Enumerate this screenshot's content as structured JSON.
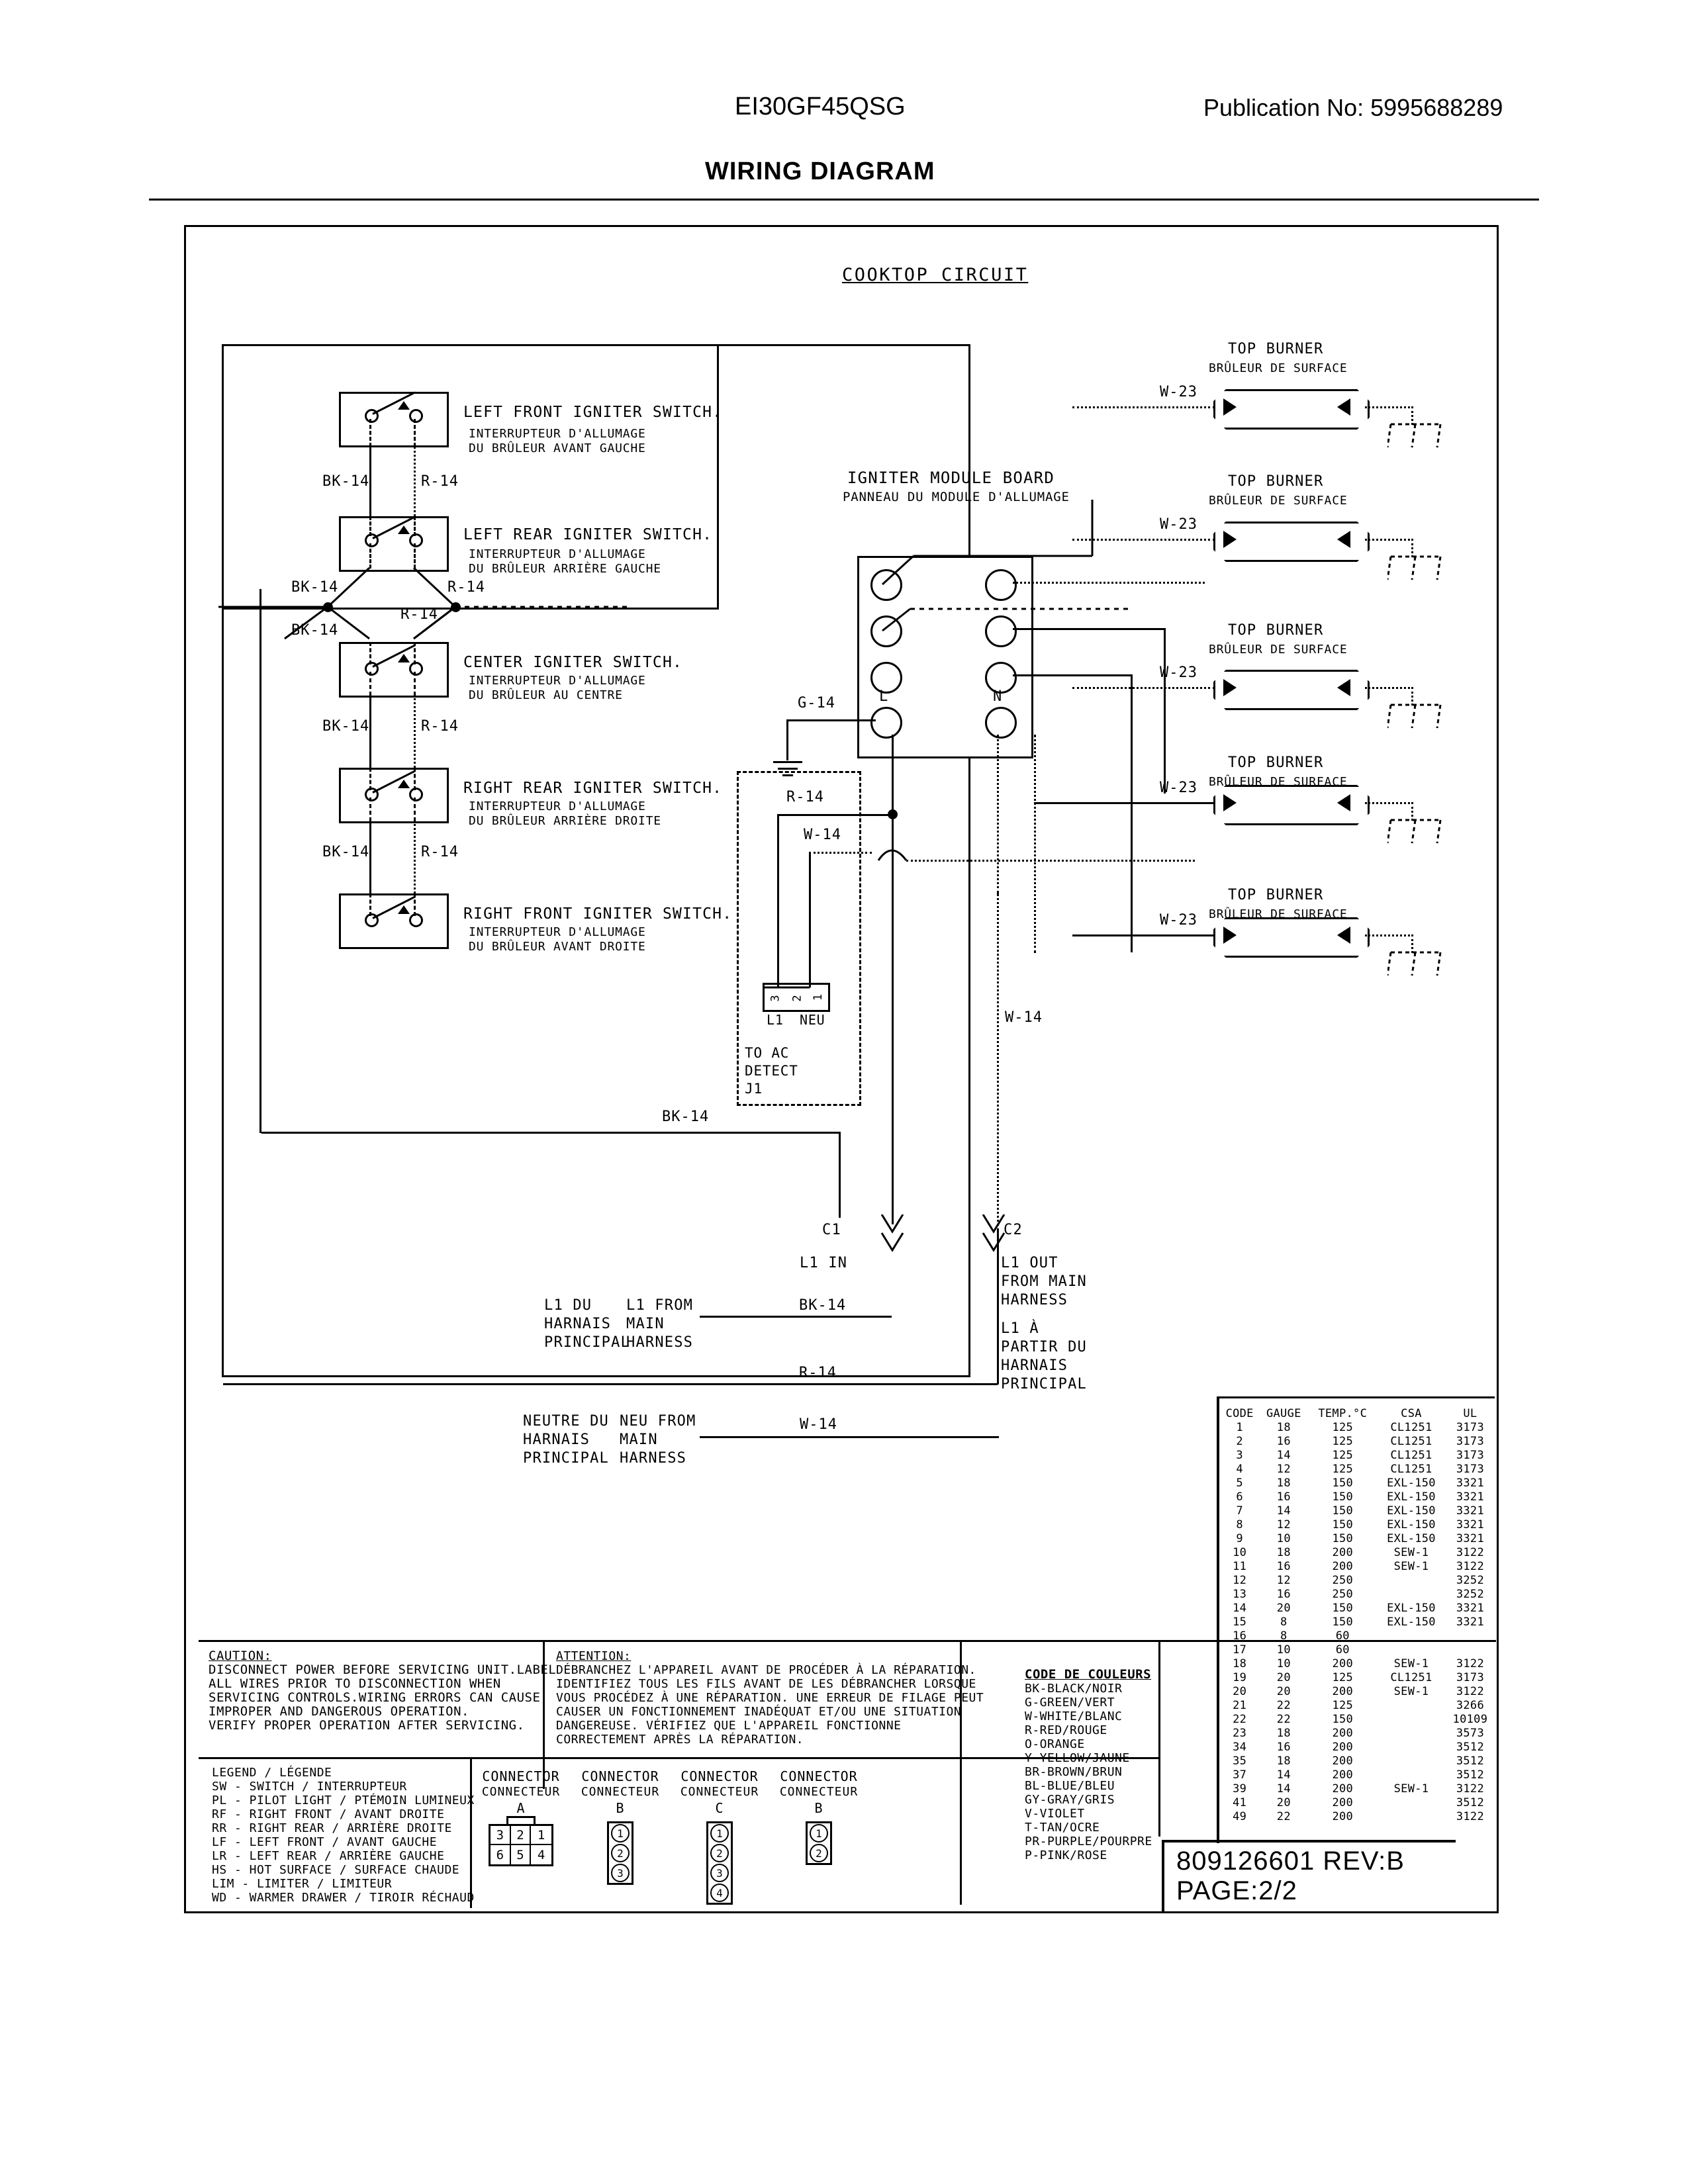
{
  "header": {
    "model": "EI30GF45QSG",
    "publication_label": "Publication No:  5995688289",
    "title": "WIRING DIAGRAM"
  },
  "diagram": {
    "section_title": "COOKTOP CIRCUIT",
    "module_board": {
      "title_en": "IGNITER MODULE BOARD",
      "title_fr": "PANNEAU DU MODULE D'ALLUMAGE",
      "terminal_l": "L",
      "terminal_n": "N",
      "ground_wire": "G-14"
    },
    "switches": [
      {
        "name_en": "LEFT FRONT IGNITER SWITCH.",
        "name_fr_1": "INTERRUPTEUR D'ALLUMAGE",
        "name_fr_2": "DU BRÛLEUR AVANT GAUCHE"
      },
      {
        "name_en": "LEFT REAR IGNITER SWITCH.",
        "name_fr_1": "INTERRUPTEUR D'ALLUMAGE",
        "name_fr_2": "DU BRÛLEUR ARRIÈRE GAUCHE"
      },
      {
        "name_en": "CENTER IGNITER SWITCH.",
        "name_fr_1": "INTERRUPTEUR D'ALLUMAGE",
        "name_fr_2": "DU BRÛLEUR AU CENTRE"
      },
      {
        "name_en": "RIGHT REAR IGNITER SWITCH.",
        "name_fr_1": "INTERRUPTEUR D'ALLUMAGE",
        "name_fr_2": "DU BRÛLEUR ARRIÈRE DROITE"
      },
      {
        "name_en": "RIGHT FRONT IGNITER SWITCH.",
        "name_fr_1": "INTERRUPTEUR D'ALLUMAGE",
        "name_fr_2": "DU BRÛLEUR AVANT DROITE"
      }
    ],
    "burners": [
      {
        "name_en": "TOP BURNER",
        "name_fr": "BRÛLEUR DE SURFACE",
        "wire": "W-23"
      },
      {
        "name_en": "TOP BURNER",
        "name_fr": "BRÛLEUR DE SURFACE",
        "wire": "W-23"
      },
      {
        "name_en": "TOP BURNER",
        "name_fr": "BRÛLEUR DE SURFACE",
        "wire": "W-23"
      },
      {
        "name_en": "TOP BURNER",
        "name_fr": "BRÛLEUR DE SURFACE",
        "wire": "W-23"
      },
      {
        "name_en": "TOP BURNER",
        "name_fr": "BRÛLEUR DE SURFACE",
        "wire": "W-23"
      }
    ],
    "wire_labels": {
      "bk14": "BK-14",
      "r14": "R-14",
      "w14": "W-14",
      "w23": "W-23",
      "g14": "G-14"
    },
    "ac_detect": {
      "r14": "R-14",
      "w14": "W-14",
      "pin3": "3",
      "pin2": "2",
      "pin1": "1",
      "l1": "L1",
      "neu": "NEU",
      "caption_1": "TO AC",
      "caption_2": "DETECT",
      "caption_3": "J1"
    },
    "harness": {
      "c1": "C1",
      "c2": "C2",
      "l1_in": "L1 IN",
      "c2_en_1": "L1 OUT",
      "c2_en_2": "FROM MAIN",
      "c2_en_3": "HARNESS",
      "c2_fr_1": "L1 À",
      "c2_fr_2": "PARTIR DU",
      "c2_fr_3": "HARNAIS",
      "c2_fr_4": "PRINCIPAL",
      "l1_fr_1": "L1 DU",
      "l1_fr_2": "HARNAIS",
      "l1_fr_3": "PRINCIPAL",
      "l1_en_1": "L1 FROM",
      "l1_en_2": "MAIN",
      "l1_en_3": "HARNESS",
      "neu_fr_1": "NEUTRE DU",
      "neu_fr_2": "HARNAIS",
      "neu_fr_3": "PRINCIPAL",
      "neu_en_1": "NEU FROM",
      "neu_en_2": "MAIN",
      "neu_en_3": "HARNESS",
      "bk14": "BK-14",
      "r14": "R-14",
      "w14": "W-14"
    }
  },
  "caution": {
    "heading": "CAUTION:",
    "lines": [
      "DISCONNECT POWER BEFORE SERVICING UNIT.LABEL",
      "ALL WIRES PRIOR TO DISCONNECTION WHEN",
      "SERVICING CONTROLS.WIRING ERRORS CAN CAUSE",
      "IMPROPER AND DANGEROUS OPERATION.",
      "VERIFY PROPER OPERATION AFTER SERVICING."
    ]
  },
  "attention": {
    "heading": "ATTENTION:",
    "lines": [
      "DÉBRANCHEZ L'APPAREIL AVANT DE PROCÉDER À LA RÉPARATION.",
      "IDENTIFIEZ TOUS LES FILS AVANT DE LES DÉBRANCHER LORSQUE",
      "VOUS PROCÉDEZ À UNE RÉPARATION. UNE ERREUR DE FILAGE PEUT",
      "CAUSER UN FONCTIONNEMENT INADÉQUAT ET/OU UNE SITUATION",
      "DANGEREUSE. VÉRIFIEZ QUE L'APPAREIL FONCTIONNE",
      "CORRECTEMENT APRÈS LA RÉPARATION."
    ]
  },
  "color_code": {
    "heading": "CODE DE COULEURS",
    "entries": [
      "BK-BLACK/NOIR",
      "G-GREEN/VERT",
      "W-WHITE/BLANC",
      "R-RED/ROUGE",
      "O-ORANGE",
      "Y-YELLOW/JAUNE",
      "BR-BROWN/BRUN",
      "BL-BLUE/BLEU",
      "GY-GRAY/GRIS",
      "V-VIOLET",
      "T-TAN/OCRE",
      "PR-PURPLE/POURPRE",
      "P-PINK/ROSE"
    ]
  },
  "legend": {
    "heading": "LEGEND / LÉGENDE",
    "entries": [
      "SW - SWITCH / INTERRUPTEUR",
      "PL - PILOT LIGHT / PTÉMOIN LUMINEUX",
      "RF - RIGHT FRONT / AVANT DROITE",
      "RR - RIGHT REAR / ARRIÈRE DROITE",
      "LF - LEFT FRONT / AVANT GAUCHE",
      "LR - LEFT REAR / ARRIÈRE GAUCHE",
      "HS - HOT SURFACE / SURFACE CHAUDE",
      "LIM - LIMITER / LIMITEUR",
      "WD - WARMER DRAWER / TIROIR RÉCHAUD"
    ]
  },
  "connectors": [
    {
      "title_en": "CONNECTOR",
      "title_fr": "CONNECTEUR",
      "id": "A",
      "type": "grid6",
      "pins": [
        "3",
        "2",
        "1",
        "6",
        "5",
        "4"
      ]
    },
    {
      "title_en": "CONNECTOR",
      "title_fr": "CONNECTEUR",
      "id": "B",
      "type": "vertical",
      "pins": [
        "1",
        "2",
        "3"
      ]
    },
    {
      "title_en": "CONNECTOR",
      "title_fr": "CONNECTEUR",
      "id": "C",
      "type": "vertical",
      "pins": [
        "1",
        "2",
        "3",
        "4"
      ]
    },
    {
      "title_en": "CONNECTOR",
      "title_fr": "CONNECTEUR",
      "id": "B",
      "type": "vertical",
      "pins": [
        "1",
        "2"
      ]
    }
  ],
  "wire_table": {
    "headers": [
      "CODE",
      "GAUGE",
      "TEMP.°C",
      "CSA",
      "UL"
    ],
    "rows": [
      [
        "1",
        "18",
        "125",
        "CL1251",
        "3173"
      ],
      [
        "2",
        "16",
        "125",
        "CL1251",
        "3173"
      ],
      [
        "3",
        "14",
        "125",
        "CL1251",
        "3173"
      ],
      [
        "4",
        "12",
        "125",
        "CL1251",
        "3173"
      ],
      [
        "5",
        "18",
        "150",
        "EXL-150",
        "3321"
      ],
      [
        "6",
        "16",
        "150",
        "EXL-150",
        "3321"
      ],
      [
        "7",
        "14",
        "150",
        "EXL-150",
        "3321"
      ],
      [
        "8",
        "12",
        "150",
        "EXL-150",
        "3321"
      ],
      [
        "9",
        "10",
        "150",
        "EXL-150",
        "3321"
      ],
      [
        "10",
        "18",
        "200",
        "SEW-1",
        "3122"
      ],
      [
        "11",
        "16",
        "200",
        "SEW-1",
        "3122"
      ],
      [
        "12",
        "12",
        "250",
        "",
        "3252"
      ],
      [
        "13",
        "16",
        "250",
        "",
        "3252"
      ],
      [
        "14",
        "20",
        "150",
        "EXL-150",
        "3321"
      ],
      [
        "15",
        "8",
        "150",
        "EXL-150",
        "3321"
      ],
      [
        "16",
        "8",
        "60",
        "",
        ""
      ],
      [
        "17",
        "10",
        "60",
        "",
        ""
      ],
      [
        "18",
        "10",
        "200",
        "SEW-1",
        "3122"
      ],
      [
        "19",
        "20",
        "125",
        "CL1251",
        "3173"
      ],
      [
        "20",
        "20",
        "200",
        "SEW-1",
        "3122"
      ],
      [
        "21",
        "22",
        "125",
        "",
        "3266"
      ],
      [
        "22",
        "22",
        "150",
        "",
        "10109"
      ],
      [
        "23",
        "18",
        "200",
        "",
        "3573"
      ],
      [
        "34",
        "16",
        "200",
        "",
        "3512"
      ],
      [
        "35",
        "18",
        "200",
        "",
        "3512"
      ],
      [
        "37",
        "14",
        "200",
        "",
        "3512"
      ],
      [
        "39",
        "14",
        "200",
        "SEW-1",
        "3122"
      ],
      [
        "41",
        "20",
        "200",
        "",
        "3512"
      ],
      [
        "49",
        "22",
        "200",
        "",
        "3122"
      ]
    ]
  },
  "part_block": {
    "part_number": "809126601  REV:B",
    "page": "PAGE:2/2"
  }
}
